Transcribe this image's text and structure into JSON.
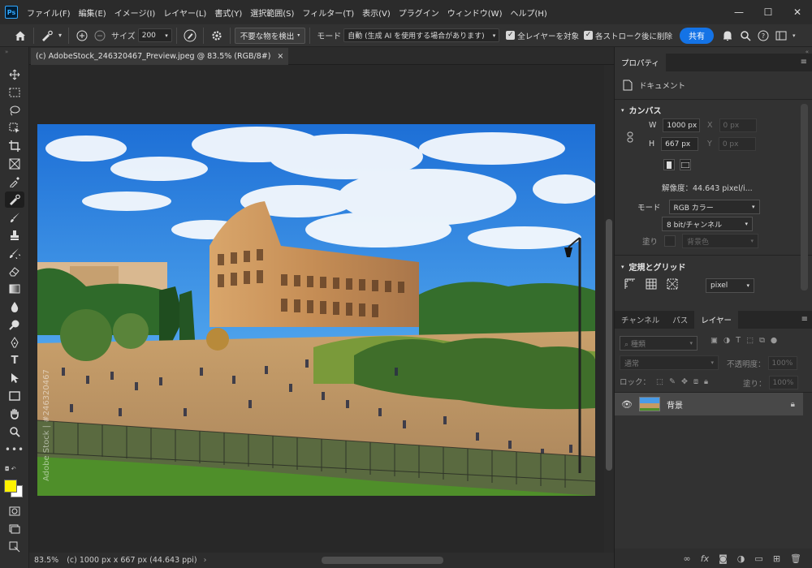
{
  "app": {
    "logo": "Ps"
  },
  "menu": [
    "ファイル(F)",
    "編集(E)",
    "イメージ(I)",
    "レイヤー(L)",
    "書式(Y)",
    "選択範囲(S)",
    "フィルター(T)",
    "表示(V)",
    "プラグイン",
    "ウィンドウ(W)",
    "ヘルプ(H)"
  ],
  "window_controls": {
    "minimize": "—",
    "maximize": "☐",
    "close": "✕"
  },
  "options": {
    "size_label": "サイズ",
    "size_value": "200",
    "remove_button": "不要な物を検出",
    "mode_label": "モード",
    "mode_value": "自動 (生成 AI を使用する場合があります)",
    "all_layers": "全レイヤーを対象",
    "delete_after": "各ストローク後に削除",
    "share": "共有"
  },
  "document": {
    "tab_title": "(c) AdobeStock_246320467_Preview.jpeg @ 83.5% (RGB/8#)",
    "tab_close": "×",
    "watermark": "Adobe Stock | #246320467"
  },
  "status": {
    "zoom": "83.5%",
    "info": "(c) 1000 px x 667 px (44.643 ppi)",
    "arrow": "›"
  },
  "properties": {
    "tab": "プロパティ",
    "doc_label": "ドキュメント",
    "canvas_header": "カンバス",
    "w_label": "W",
    "w_value": "1000 px",
    "h_label": "H",
    "h_value": "667 px",
    "x_label": "X",
    "x_value": "0 px",
    "y_label": "Y",
    "y_value": "0 px",
    "resolution": "解像度：44.643 pixel/i...",
    "mode_label": "モード",
    "mode_value": "RGB カラー",
    "depth_value": "8 bit/チャンネル",
    "fill_label": "塗り",
    "fill_value": "背景色",
    "rulers_header": "定規とグリッド",
    "unit_value": "pixel"
  },
  "layers_panel": {
    "tabs": [
      "チャンネル",
      "パス",
      "レイヤー"
    ],
    "search_placeholder": "種類",
    "blend_mode": "通常",
    "opacity_label": "不透明度：",
    "opacity_value": "100%",
    "lock_label": "ロック：",
    "fill_label": "塗り：",
    "fill_value": "100%",
    "layer_name": "背景"
  }
}
